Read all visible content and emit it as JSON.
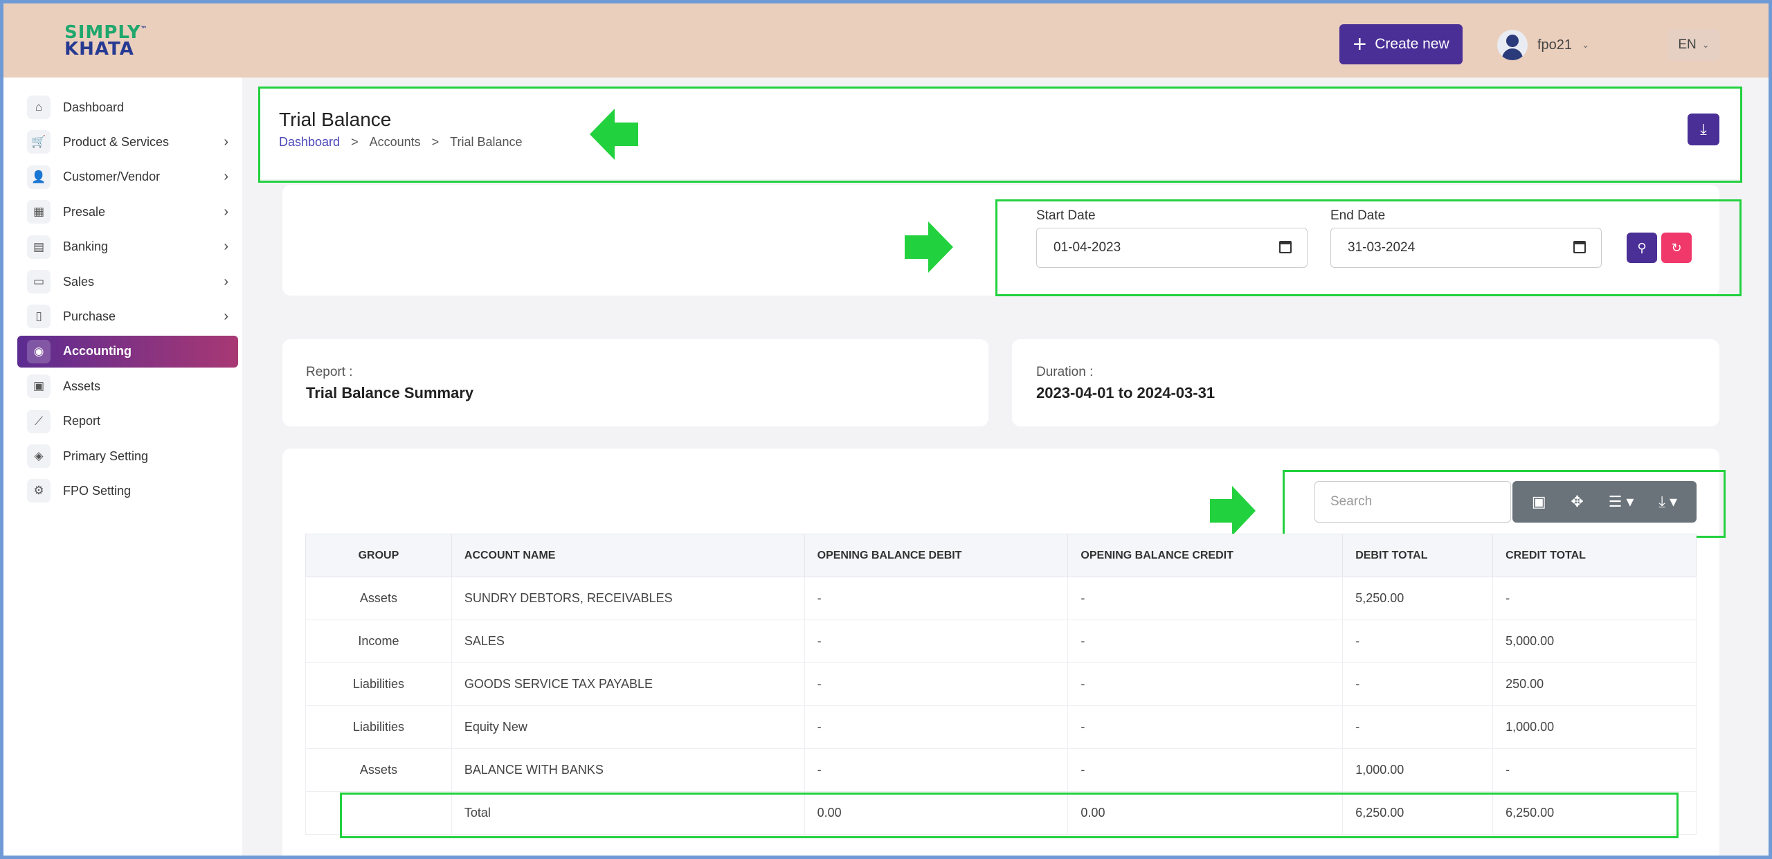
{
  "header": {
    "logo_line1": "SIMPLY",
    "logo_line2": "KHATA",
    "logo_tm": "™",
    "create_label": "Create new",
    "user_name": "fpo21",
    "language": "EN"
  },
  "sidebar": {
    "items": [
      {
        "label": "Dashboard",
        "icon": "home-icon",
        "glyph": "⌂",
        "arrow": ""
      },
      {
        "label": "Product & Services",
        "icon": "cart-icon",
        "glyph": "🛒",
        "arrow": "›"
      },
      {
        "label": "Customer/Vendor",
        "icon": "user-plus-icon",
        "glyph": "👤",
        "arrow": "›"
      },
      {
        "label": "Presale",
        "icon": "store-icon",
        "glyph": "▦",
        "arrow": "›"
      },
      {
        "label": "Banking",
        "icon": "bank-icon",
        "glyph": "▤",
        "arrow": "›"
      },
      {
        "label": "Sales",
        "icon": "document-icon",
        "glyph": "▭",
        "arrow": "›"
      },
      {
        "label": "Purchase",
        "icon": "bag-icon",
        "glyph": "▯",
        "arrow": "›"
      },
      {
        "label": "Accounting",
        "icon": "accounting-icon",
        "glyph": "◉",
        "arrow": ""
      },
      {
        "label": "Assets",
        "icon": "calculator-icon",
        "glyph": "▣",
        "arrow": ""
      },
      {
        "label": "Report",
        "icon": "chart-icon",
        "glyph": "⟋",
        "arrow": ""
      },
      {
        "label": "Primary Setting",
        "icon": "tag-icon",
        "glyph": "◈",
        "arrow": ""
      },
      {
        "label": "FPO Setting",
        "icon": "gear-icon",
        "glyph": "⚙",
        "arrow": ""
      }
    ],
    "active_index": 7
  },
  "page": {
    "title": "Trial Balance",
    "breadcrumb": [
      "Dashboard",
      "Accounts",
      "Trial Balance"
    ],
    "breadcrumb_sep": ">"
  },
  "filter": {
    "start_label": "Start Date",
    "start_value": "01-04-2023",
    "end_label": "End Date",
    "end_value": "31-03-2024"
  },
  "report": {
    "report_label": "Report :",
    "report_value": "Trial Balance Summary",
    "duration_label": "Duration :",
    "duration_value": "2023-04-01 to 2024-03-31"
  },
  "table": {
    "search_placeholder": "Search",
    "columns": [
      "GROUP",
      "ACCOUNT NAME",
      "OPENING BALANCE DEBIT",
      "OPENING BALANCE CREDIT",
      "DEBIT TOTAL",
      "CREDIT TOTAL"
    ],
    "rows": [
      [
        "Assets",
        "SUNDRY DEBTORS, RECEIVABLES",
        "-",
        "-",
        "5,250.00",
        "-"
      ],
      [
        "Income",
        "SALES",
        "-",
        "-",
        "-",
        "5,000.00"
      ],
      [
        "Liabilities",
        "GOODS SERVICE TAX PAYABLE",
        "-",
        "-",
        "-",
        "250.00"
      ],
      [
        "Liabilities",
        "Equity New",
        "-",
        "-",
        "-",
        "1,000.00"
      ],
      [
        "Assets",
        "BALANCE WITH BANKS",
        "-",
        "-",
        "1,000.00",
        "-"
      ]
    ],
    "total_row": [
      "",
      "Total",
      "0.00",
      "0.00",
      "6,250.00",
      "6,250.00"
    ]
  },
  "colors": {
    "header_bg": "#ebcfbd",
    "primary": "#4a2f97",
    "reset": "#f0386b",
    "highlight": "#22d13e",
    "active_gradient_start": "#5b2c91",
    "active_gradient_end": "#a83874"
  }
}
